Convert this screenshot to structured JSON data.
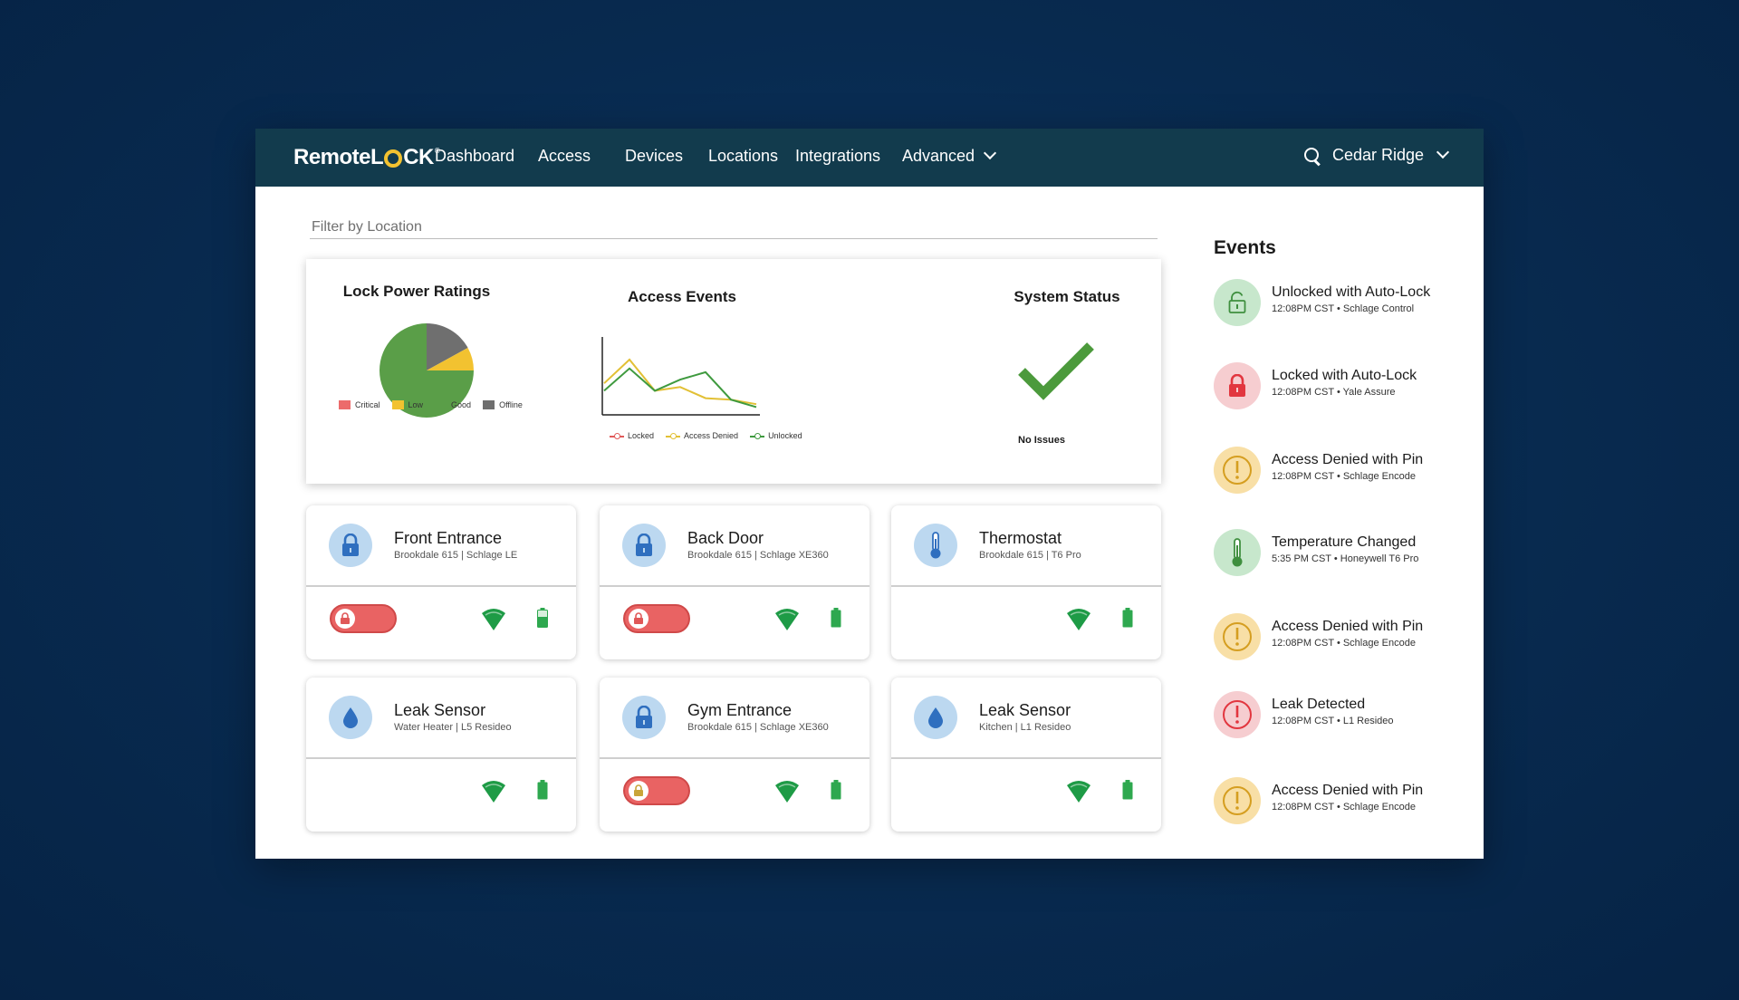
{
  "app": {
    "logo_remote": "Remote",
    "logo_l": "L",
    "logo_ck": "CK",
    "logo_tm": "®"
  },
  "nav": {
    "items": [
      {
        "label": "Dashboard"
      },
      {
        "label": "Access"
      },
      {
        "label": "Devices"
      },
      {
        "label": "Locations"
      },
      {
        "label": "Integrations"
      },
      {
        "label": "Advanced"
      }
    ],
    "location_label": "Cedar Ridge"
  },
  "filter": {
    "placeholder": "Filter by Location"
  },
  "stats": {
    "lock_power_title": "Lock Power Ratings",
    "access_events_title": "Access Events",
    "system_status_title": "System Status",
    "system_status_text": "No Issues",
    "pie_legend": [
      {
        "label": "Critical",
        "color": "#ec6b6b"
      },
      {
        "label": "Low",
        "color": "#f2c230"
      },
      {
        "label": "Good",
        "color": "#5a9e48"
      },
      {
        "label": "Offline",
        "color": "#6f6f6f"
      }
    ],
    "line_legend": [
      {
        "label": "Locked",
        "color": "#e05a5a"
      },
      {
        "label": "Access Denied",
        "color": "#e2c035"
      },
      {
        "label": "Unlocked",
        "color": "#3f9a3f"
      }
    ]
  },
  "chart_data": [
    {
      "type": "pie",
      "title": "Lock Power Ratings",
      "categories": [
        "Critical",
        "Low",
        "Good",
        "Offline"
      ],
      "values": [
        0,
        8,
        75,
        17
      ],
      "colors": [
        "#ec6b6b",
        "#f2c230",
        "#5a9e48",
        "#6f6f6f"
      ],
      "legend": "bottom"
    },
    {
      "type": "line",
      "title": "Access Events",
      "x": [
        1,
        2,
        3,
        4,
        5,
        6,
        7
      ],
      "series": [
        {
          "name": "Locked",
          "values": [
            0,
            0,
            0,
            0,
            0,
            0,
            0
          ],
          "color": "#e05a5a"
        },
        {
          "name": "Access Denied",
          "values": [
            40,
            72,
            30,
            35,
            20,
            18,
            12
          ],
          "color": "#e2c035"
        },
        {
          "name": "Unlocked",
          "values": [
            30,
            60,
            30,
            45,
            55,
            18,
            8
          ],
          "color": "#3f9a3f"
        }
      ],
      "ylim": [
        0,
        100
      ],
      "legend": "bottom",
      "grid": false
    }
  ],
  "devices": [
    {
      "name": "Front Entrance",
      "sub": "Brookdale 615 | Schlage LE",
      "icon": "padlock-icon",
      "has_lock": true
    },
    {
      "name": "Back Door",
      "sub": "Brookdale 615 | Schlage XE360",
      "icon": "padlock-icon",
      "has_lock": true
    },
    {
      "name": "Thermostat",
      "sub": "Brookdale 615 | T6 Pro",
      "icon": "thermometer-icon",
      "has_lock": false
    },
    {
      "name": "Leak Sensor",
      "sub": "Water Heater | L5 Resideo",
      "icon": "water-drop-icon",
      "has_lock": false
    },
    {
      "name": "Gym Entrance",
      "sub": "Brookdale 615 | Schlage XE360",
      "icon": "padlock-icon",
      "has_lock": true
    },
    {
      "name": "Leak Sensor",
      "sub": "Kitchen | L1 Resideo",
      "icon": "water-drop-icon",
      "has_lock": false
    }
  ],
  "events": {
    "title": "Events",
    "items": [
      {
        "title": "Unlocked with Auto-Lock",
        "sub": "12:08PM CST • Schlage Control",
        "icon": "unlocked-padlock-icon",
        "color": "green"
      },
      {
        "title": "Locked with Auto-Lock",
        "sub": "12:08PM CST • Yale Assure",
        "icon": "locked-padlock-icon",
        "color": "red"
      },
      {
        "title": "Access Denied with Pin",
        "sub": "12:08PM CST • Schlage Encode",
        "icon": "warning-icon",
        "color": "yellow"
      },
      {
        "title": "Temperature Changed",
        "sub": "5:35 PM CST • Honeywell T6 Pro",
        "icon": "thermometer-icon",
        "color": "green"
      },
      {
        "title": "Access Denied with Pin",
        "sub": "12:08PM CST • Schlage Encode",
        "icon": "warning-icon",
        "color": "yellow"
      },
      {
        "title": "Leak Detected",
        "sub": "12:08PM CST • L1 Resideo",
        "icon": "alert-icon",
        "color": "red"
      },
      {
        "title": "Access Denied with Pin",
        "sub": "12:08PM CST • Schlage Encode",
        "icon": "warning-icon",
        "color": "yellow"
      }
    ]
  }
}
